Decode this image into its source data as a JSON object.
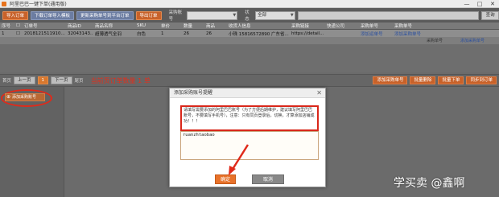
{
  "window": {
    "title": "阿里巴巴一键下单(通用版)",
    "min": "—",
    "max": "□",
    "close": "✕"
  },
  "toolbar": {
    "buttons": [
      "导入订单",
      "下载订单导入模板",
      "更新采购单号到平台订单",
      "导出订单"
    ],
    "account_label": "采购账号",
    "status_label": "状态",
    "status_value": "全部",
    "search_label": "查询"
  },
  "table": {
    "headers": [
      "序号",
      "",
      "订单号",
      "商品ID",
      "商品名称",
      "SKU",
      "单价",
      "数量",
      "商品",
      "收货人信息",
      "采购链接",
      "快递公司",
      "采购单号",
      "采购单号"
    ],
    "row": [
      "1",
      "",
      "2018121511910...",
      "32043143...",
      "超薄透气全羽",
      "白色",
      "1",
      "26",
      "26",
      "小珠 15816572890 广东省...",
      "https://detail...",
      "",
      "添加运单号",
      "添加采购单号"
    ],
    "row2": [
      "",
      "",
      "",
      "",
      "",
      "",
      "",
      "",
      "",
      "",
      "",
      "",
      "采购单号",
      "添加采购单号"
    ]
  },
  "pager": {
    "home": "首页",
    "prev": "上一页",
    "page": "1",
    "next": "下一页",
    "last": "尾页",
    "count_text": "当前页订单数量 1 单",
    "right_buttons": [
      "添加采购单号",
      "批量删除",
      "批量下单",
      "同步到订单"
    ]
  },
  "left_panel": {
    "add_account": "添加采购账号"
  },
  "dialog": {
    "title": "添加采购账号提醒",
    "close": "✕",
    "notice": "请填写需要添加的阿里巴巴账号（为了方便后期维护，建议填写阿里巴巴账号，不要填写手机号），注意：只有同页登录后，切换，才算添加店铺成功！！！",
    "textarea_value": "ruanzhtaobao",
    "ok_label": "确定",
    "cancel_label": "取消"
  },
  "watermark": "学买卖 @鑫啊",
  "colors": {
    "accent": "#e8722a",
    "highlight": "#d9271a",
    "link": "#2a4fa0"
  }
}
